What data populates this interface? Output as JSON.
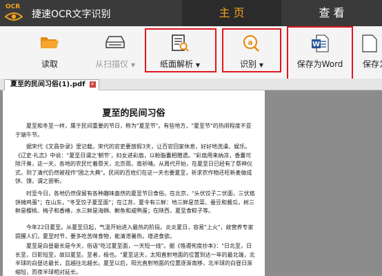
{
  "app": {
    "logo_text": "OCR",
    "title": "捷速OCR文字识别"
  },
  "tabs": {
    "home": "主 页",
    "view": "查 看"
  },
  "ribbon": {
    "read": "读取",
    "scan": "从扫描仪",
    "layout": "纸面解析",
    "recognize": "识别",
    "save_word": "保存为Word",
    "save_more": "保存为"
  },
  "document": {
    "tab_name": "夏至的民间习俗(1).pdf",
    "title": "夏至的民间习俗",
    "paragraphs": [
      "夏至和冬至一样，属于民间重要的节日，称为\"夏至节\"。有些地方，\"夏至节\"的热闹程度不亚于端午节。",
      "据宋代《文昌杂录》里记载，宋代的官吏要放假3天，让百官回家休息，好好地洗澡、娱乐。《辽史·礼志》中说：\"夏至日谓之'朝节'，妇女进彩扇，以粉脂囊相赠遗。\"彩扇用来纳凉，香囊可除汗臭，这一天，各地的农民忙着祭天，北京雨，南祈晴。从周代开始，在夏至日已经有了祭神仪式，到了清代仍然被视作\"国之大典\"。民间的百姓们在这一天也要夏至，祈求农作物还旺新麦做成饼、馍，谓之尝新。",
      "时至今日，各地仍然保留有各种趣味盎然的夏至节日食俗。在北京，\"头伏饺子二伏面，三伏烙饼摊鸡蛋\"；在山东，\"冬至饺子夏至面\"；在江苏，夏令有三鲜：地三鲜是苋菜、蚕豆和酱瓜，树三鲜是樱桃、梅子和香椿，水三鲜是海蛳、鲥鱼和咸鸭蛋；在陕西，夏至食粽子等。",
      "今年22日夏至。从夏至日起，气温开始进入最热的阶段。炎炎夏日，容易\"上火\"，故营养专家提醒人们，夏至时节，要多吃苦味食物，能清泄暑热，增进食欲。",
      "夏至是白昼最长是今天，俗语\"吃过夏至面，一天短一线\"。据《恪遵宪度抄本》：\"日北至，日长至，日影短至，故曰夏至。至者，极也。\"夏至这天，太阳直射地面的位置到达一年的最北端，北半球的白昼达最长，且越往北越长。夏至以后，阳光直射地面的位置逐渐南移，北半球的白昼日渐缩短，而夜半球相对延长。"
    ]
  }
}
